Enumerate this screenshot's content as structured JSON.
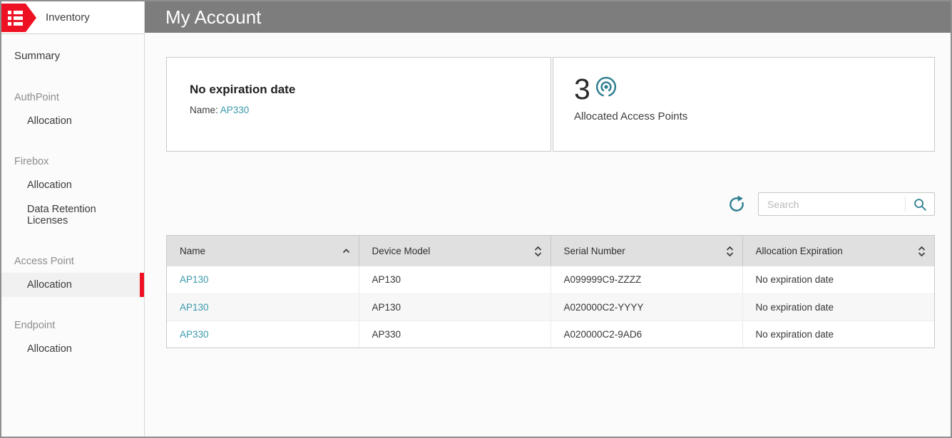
{
  "sidebar": {
    "title": "Inventory",
    "items": {
      "summary": "Summary",
      "authpoint": "AuthPoint",
      "authpoint_allocation": "Allocation",
      "firebox": "Firebox",
      "firebox_allocation": "Allocation",
      "firebox_data_retention": "Data Retention Licenses",
      "access_point": "Access Point",
      "access_point_allocation": "Allocation",
      "endpoint": "Endpoint",
      "endpoint_allocation": "Allocation"
    },
    "selected_item": "Allocation (Access Point)"
  },
  "header": {
    "title": "My Account"
  },
  "cards": {
    "expiration": {
      "title": "No expiration date",
      "name_label": "Name:",
      "name_value": "AP330"
    },
    "allocated": {
      "count": "3",
      "label": "Allocated Access Points"
    }
  },
  "toolbar": {
    "search_placeholder": "Search"
  },
  "table": {
    "columns": {
      "name": {
        "label": "Name",
        "sort": "asc"
      },
      "device_model": {
        "label": "Device Model",
        "sort": "none"
      },
      "serial_number": {
        "label": "Serial Number",
        "sort": "none"
      },
      "allocation_expiration": {
        "label": "Allocation Expiration",
        "sort": "none"
      }
    },
    "rows": [
      {
        "name": "AP130",
        "device_model": "AP130",
        "serial_number": "A099999C9-ZZZZ",
        "allocation_expiration": "No expiration date"
      },
      {
        "name": "AP130",
        "device_model": "AP130",
        "serial_number": "A020000C2-YYYY",
        "allocation_expiration": "No expiration date"
      },
      {
        "name": "AP330",
        "device_model": "AP330",
        "serial_number": "A020000C2-9AD6",
        "allocation_expiration": "No expiration date"
      }
    ]
  },
  "colors": {
    "accent_teal": "#3a99ac",
    "icon_teal": "#2e7f90",
    "brand_red": "#ee1123",
    "header_gray": "#7d7d7d",
    "table_header_gray": "#e0e0e0"
  }
}
